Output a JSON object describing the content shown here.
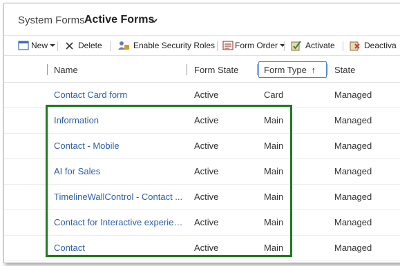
{
  "header": {
    "breadcrumb": "System Forms",
    "view_title": "Active Forms"
  },
  "commandbar": {
    "new_label": "New",
    "delete_label": "Delete",
    "security_roles_label": "Enable Security Roles",
    "form_order_label": "Form Order",
    "activate_label": "Activate",
    "deactivate_label": "Deactiva"
  },
  "grid": {
    "columns": [
      {
        "label": "Name"
      },
      {
        "label": "Form State"
      },
      {
        "label": "Form Type",
        "sort_glyph": "↑",
        "sorted": true
      },
      {
        "label": "State"
      }
    ],
    "rows": [
      {
        "name": "Contact Card form",
        "form_state": "Active",
        "form_type": "Card",
        "state": "Managed"
      },
      {
        "name": "Information",
        "form_state": "Active",
        "form_type": "Main",
        "state": "Managed"
      },
      {
        "name": "Contact - Mobile",
        "form_state": "Active",
        "form_type": "Main",
        "state": "Managed"
      },
      {
        "name": "AI for Sales",
        "form_state": "Active",
        "form_type": "Main",
        "state": "Managed"
      },
      {
        "name": "TimelineWallControl - Contact ...",
        "form_state": "Active",
        "form_type": "Main",
        "state": "Managed"
      },
      {
        "name": "Contact for Interactive experience",
        "form_state": "Active",
        "form_type": "Main",
        "state": "Managed"
      },
      {
        "name": "Contact",
        "form_state": "Active",
        "form_type": "Main",
        "state": "Managed"
      }
    ]
  },
  "colors": {
    "link": "#2d5fa6",
    "highlight": "#1e7a1e",
    "sort_focus": "#4a7fd0"
  }
}
